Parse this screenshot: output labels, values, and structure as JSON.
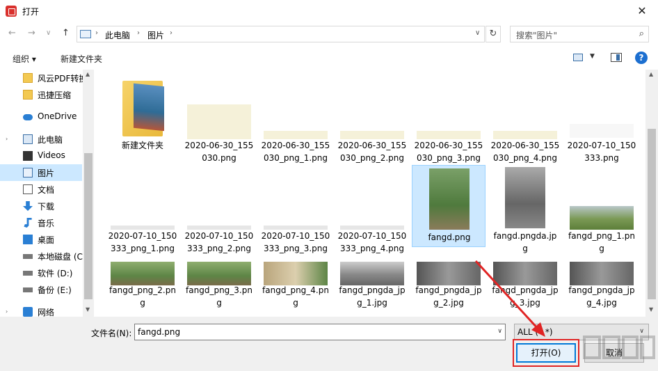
{
  "window": {
    "title": "打开",
    "close": "✕"
  },
  "nav": {
    "back": "←",
    "forward": "→",
    "recent": "∨",
    "up": "↑"
  },
  "address": {
    "crumbs": [
      "此电脑",
      "图片"
    ],
    "sep": "›",
    "refresh": "↻"
  },
  "search": {
    "placeholder": "搜索\"图片\"",
    "icon": "⌕"
  },
  "toolbar": {
    "organize": "组织 ▾",
    "new_folder": "新建文件夹",
    "help": "?"
  },
  "sidebar": {
    "items": [
      {
        "label": "风云PDF转换",
        "icon": "folder-icon"
      },
      {
        "label": "迅捷压缩",
        "icon": "folder-icon"
      },
      {
        "label": "OneDrive",
        "icon": "cloud-icon"
      },
      {
        "label": "此电脑",
        "icon": "computer-icon"
      },
      {
        "label": "Videos",
        "icon": "video-icon"
      },
      {
        "label": "图片",
        "icon": "pictures-icon"
      },
      {
        "label": "文档",
        "icon": "document-icon"
      },
      {
        "label": "下载",
        "icon": "download-icon"
      },
      {
        "label": "音乐",
        "icon": "music-icon"
      },
      {
        "label": "桌面",
        "icon": "desktop-icon"
      },
      {
        "label": "本地磁盘 (C",
        "icon": "drive-icon"
      },
      {
        "label": "软件 (D:)",
        "icon": "drive-icon"
      },
      {
        "label": "备份 (E:)",
        "icon": "drive-icon"
      },
      {
        "label": "网络",
        "icon": "network-icon"
      }
    ]
  },
  "files": [
    {
      "l1": "新建文件夹",
      "l2": "",
      "kind": "folder"
    },
    {
      "l1": "2020-06-30_155",
      "l2": "030.png",
      "kind": "formula"
    },
    {
      "l1": "2020-06-30_155",
      "l2": "030_png_1.png",
      "kind": "formula-strip"
    },
    {
      "l1": "2020-06-30_155",
      "l2": "030_png_2.png",
      "kind": "formula-strip"
    },
    {
      "l1": "2020-06-30_155",
      "l2": "030_png_3.png",
      "kind": "formula-strip"
    },
    {
      "l1": "2020-06-30_155",
      "l2": "030_png_4.png",
      "kind": "formula-strip"
    },
    {
      "l1": "2020-07-10_150",
      "l2": "333.png",
      "kind": "text-doc"
    },
    {
      "l1": "2020-07-10_150",
      "l2": "333_png_1.png",
      "kind": "text-line"
    },
    {
      "l1": "2020-07-10_150",
      "l2": "333_png_2.png",
      "kind": "text-line"
    },
    {
      "l1": "2020-07-10_150",
      "l2": "333_png_3.png",
      "kind": "text-line"
    },
    {
      "l1": "2020-07-10_150",
      "l2": "333_png_4.png",
      "kind": "text-line"
    },
    {
      "l1": "fangd.png",
      "l2": "",
      "kind": "photo-tall"
    },
    {
      "l1": "fangd.pngda.jp",
      "l2": "g",
      "kind": "photo-tall-gray"
    },
    {
      "l1": "fangd_png_1.pn",
      "l2": "g",
      "kind": "landscape"
    },
    {
      "l1": "fangd_png_2.pn",
      "l2": "g",
      "kind": "photo-wide"
    },
    {
      "l1": "fangd_png_3.pn",
      "l2": "g",
      "kind": "photo-wide"
    },
    {
      "l1": "fangd_png_4.pn",
      "l2": "g",
      "kind": "photo-wide-stone"
    },
    {
      "l1": "fangd_pngda_jp",
      "l2": "g_1.jpg",
      "kind": "gray-landscape"
    },
    {
      "l1": "fangd_pngda_jp",
      "l2": "g_2.jpg",
      "kind": "gray-photo"
    },
    {
      "l1": "fangd_pngda_jp",
      "l2": "g_3.jpg",
      "kind": "gray-photo"
    },
    {
      "l1": "fangd_pngda_jp",
      "l2": "g_4.jpg",
      "kind": "gray-photo"
    }
  ],
  "bottom": {
    "filename_label": "文件名(N):",
    "filename_value": "fangd.png",
    "filetype_value": "ALL (*.*)",
    "open_label": "打开(O)",
    "cancel_label": "取消"
  },
  "colors": {
    "accent": "#0078d7",
    "selection": "#cce8ff",
    "annotation": "#e02424"
  }
}
